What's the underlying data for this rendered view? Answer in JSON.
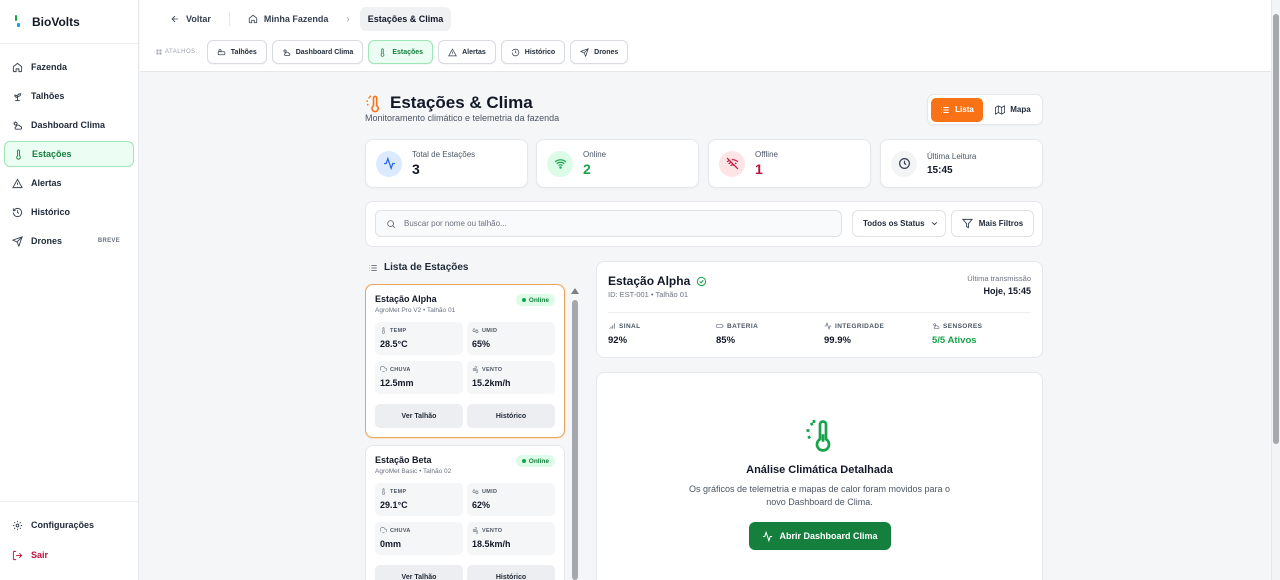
{
  "brand": {
    "name": "BioVolts"
  },
  "sidebar": {
    "items": [
      {
        "label": "Fazenda",
        "icon": "home-icon"
      },
      {
        "label": "Talhões",
        "icon": "sprout-icon"
      },
      {
        "label": "Dashboard Clima",
        "icon": "cloud-sun-icon"
      },
      {
        "label": "Estações",
        "icon": "thermometer-icon",
        "active": true
      },
      {
        "label": "Alertas",
        "icon": "alert-triangle-icon"
      },
      {
        "label": "Histórico",
        "icon": "history-icon"
      },
      {
        "label": "Drones",
        "icon": "send-icon",
        "badge": "BREVE"
      }
    ],
    "settings_label": "Configurações",
    "logout_label": "Sair"
  },
  "breadcrumb": {
    "back_label": "Voltar",
    "farm_label": "Minha Fazenda",
    "current_label": "Estações & Clima"
  },
  "shortcuts": {
    "label": "ATALHOS:",
    "items": [
      "Talhões",
      "Dashboard Clima",
      "Estações",
      "Alertas",
      "Histórico",
      "Drones"
    ]
  },
  "page": {
    "title": "Estações & Clima",
    "subtitle": "Monitoramento climático e telemetria da fazenda",
    "view_list_label": "Lista",
    "view_map_label": "Mapa"
  },
  "stats": [
    {
      "label": "Total de Estações",
      "value": "3",
      "color": "#111827"
    },
    {
      "label": "Online",
      "value": "2",
      "color": "#16a34a"
    },
    {
      "label": "Offline",
      "value": "1",
      "color": "#be123c"
    },
    {
      "label": "Última Leitura",
      "value": "15:45",
      "color": "#111827"
    }
  ],
  "search": {
    "placeholder": "Buscar por nome ou talhão...",
    "status_filter": "Todos os Status",
    "more_filters_label": "Mais Filtros"
  },
  "station_list": {
    "heading": "Lista de Estações",
    "metric_labels": {
      "temp": "TEMP",
      "umid": "UMID",
      "chuva": "CHUVA",
      "vento": "VENTO"
    },
    "btn_talhao": "Ver Talhão",
    "btn_history": "Histórico",
    "stations": [
      {
        "name": "Estação Alpha",
        "sub": "AgroMet Pro V2 • Talhão 01",
        "status": "Online",
        "temp": "28.5°C",
        "umid": "65%",
        "chuva": "12.5mm",
        "vento": "15.2km/h"
      },
      {
        "name": "Estação Beta",
        "sub": "AgroMet Basic • Talhão 02",
        "status": "Online",
        "temp": "29.1°C",
        "umid": "62%",
        "chuva": "0mm",
        "vento": "18.5km/h"
      }
    ]
  },
  "detail": {
    "name": "Estação Alpha",
    "id_line": "ID: EST-001 • Talhão 01",
    "last_tx_label": "Última transmissão",
    "last_tx_value": "Hoje, 15:45",
    "metrics": [
      {
        "label": "SINAL",
        "value": "92%"
      },
      {
        "label": "BATERIA",
        "value": "85%"
      },
      {
        "label": "INTEGRIDADE",
        "value": "99.9%"
      },
      {
        "label": "SENSORES",
        "value": "5/5 Ativos"
      }
    ]
  },
  "analysis": {
    "title": "Análise Climática Detalhada",
    "text": "Os gráficos de telemetria e mapas de calor foram movidos para o novo Dashboard de Clima.",
    "button_label": "Abrir Dashboard Clima"
  },
  "colors": {
    "accent_green": "#15803d",
    "accent_orange": "#f97316",
    "offline_red": "#be123c"
  }
}
